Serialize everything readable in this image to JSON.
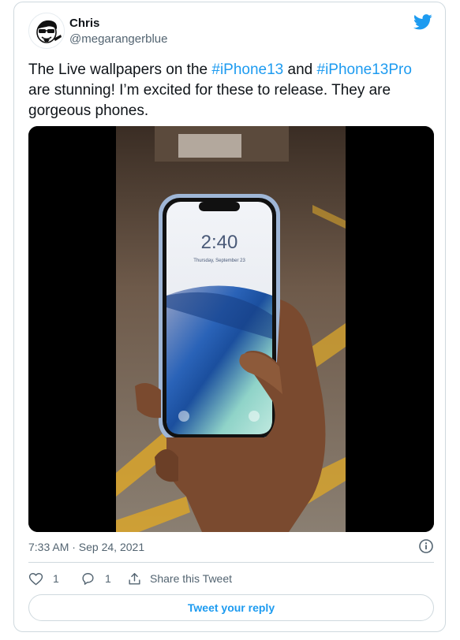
{
  "author": {
    "name": "Chris",
    "handle": "@megarangerblue"
  },
  "tweet": {
    "text_before_1": "The Live wallpapers on the ",
    "hashtag_1": "#iPhone13",
    "text_between": " and ",
    "hashtag_2": "#iPhone13Pro",
    "text_after": " are stunning! I’m excited for these to release. They are gorgeous phones."
  },
  "media": {
    "type": "video",
    "phone_time": "2:40",
    "phone_date": "Thursday, September 23"
  },
  "meta": {
    "timestamp": "7:33 AM · Sep 24, 2021"
  },
  "actions": {
    "likes": "1",
    "replies": "1",
    "share_label": "Share this Tweet"
  },
  "reply_button": {
    "label": "Tweet your reply"
  },
  "colors": {
    "accent": "#1d9bf0",
    "text": "#0f1419",
    "muted": "#536471",
    "border": "#cfd9de"
  },
  "icons": {
    "brand": "twitter-bird-icon",
    "info": "info-icon",
    "like": "heart-icon",
    "reply": "reply-icon",
    "share": "share-icon"
  }
}
